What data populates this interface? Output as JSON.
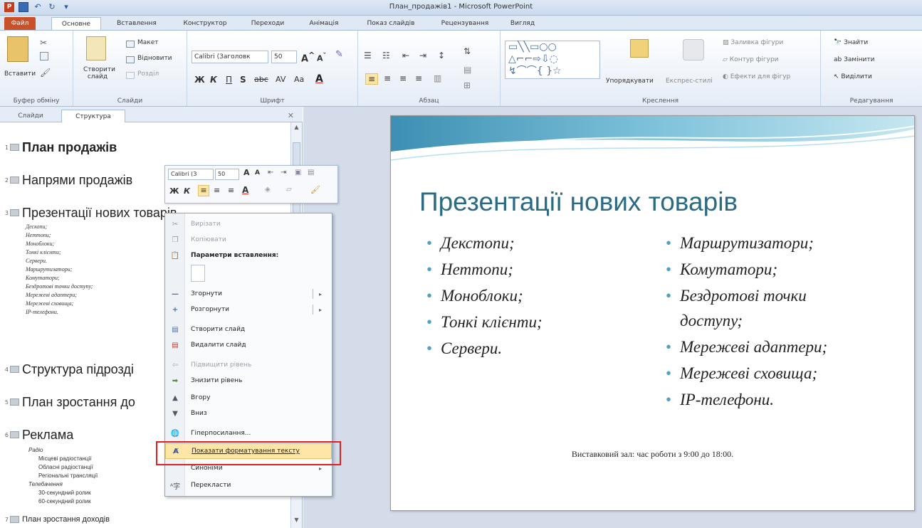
{
  "window": {
    "title": "План_продажів1 - Microsoft PowerPoint",
    "app_logo": "P"
  },
  "ribbon_tabs": [
    "Файл",
    "Основне",
    "Вставлення",
    "Конструктор",
    "Переходи",
    "Анімація",
    "Показ слайдів",
    "Рецензування",
    "Вигляд"
  ],
  "ribbon": {
    "clipboard": {
      "paste": "Вставити",
      "label": "Буфер обміну"
    },
    "slides": {
      "new_slide": "Створити слайд",
      "layout": "Макет",
      "reset": "Відновити",
      "section": "Розділ",
      "label": "Слайди"
    },
    "font": {
      "font_name": "Calibri (Заголовк",
      "font_size": "50",
      "label": "Шрифт",
      "bold": "Ж",
      "italic": "К",
      "underline": "П",
      "strike": "S",
      "case": "Aa"
    },
    "paragraph": {
      "label": "Абзац"
    },
    "drawing": {
      "arrange": "Упорядкувати",
      "quick_styles": "Експрес-стилі",
      "fill": "Заливка фігури",
      "outline": "Контур фігури",
      "effects": "Ефекти для фігур",
      "label": "Креслення"
    },
    "editing": {
      "find": "Знайти",
      "replace": "Замінити",
      "select": "Виділити",
      "label": "Редагування"
    }
  },
  "pane": {
    "tabs": [
      "Слайди",
      "Структура"
    ],
    "slides": [
      {
        "num": "1",
        "title": "План продажів"
      },
      {
        "num": "2",
        "title": "Напрями продажів"
      },
      {
        "num": "3",
        "title": "Презентації нових товарів"
      },
      {
        "num": "4",
        "title": "Структура підрозді"
      },
      {
        "num": "5",
        "title": "План зростання до"
      },
      {
        "num": "6",
        "title": "Реклама"
      },
      {
        "num": "7",
        "title": "План зростання доходів"
      }
    ],
    "slide3_items": [
      "Дескопи;",
      "Неттопи;",
      "Моноблоки;",
      "Тонкі клієнти;",
      "Сервери.",
      "Маршрутизатори;",
      "Комутатори;",
      "Бездротові точки доступу;",
      "Мережеві адаптери;",
      "Мережеві сховища;",
      "IP-телефони."
    ],
    "slide6_items": [
      "Радіо",
      "Місцеві радіостанції",
      "Обласні радіостанції",
      "Регіональні трансляції",
      "Телебачення",
      "30-секундний ролик",
      "60-секундний ролик"
    ]
  },
  "mini_toolbar": {
    "font_name": "Calibri (З",
    "font_size": "50"
  },
  "context_menu": {
    "items": [
      {
        "label": "Вирізати",
        "icon": "scissors-icon",
        "disabled": true
      },
      {
        "label": "Копіювати",
        "icon": "copy-icon",
        "disabled": true
      },
      {
        "label": "Параметри вставлення:",
        "icon": "paste-icon",
        "disabled": false,
        "bold": true
      },
      {
        "label": "Згорнути",
        "icon": "collapse-icon",
        "disabled": false,
        "submenu": true
      },
      {
        "label": "Розгорнути",
        "icon": "expand-icon",
        "disabled": false,
        "submenu": true
      },
      {
        "label": "Створити слайд",
        "icon": "new-slide-icon",
        "disabled": false
      },
      {
        "label": "Видалити слайд",
        "icon": "delete-slide-icon",
        "disabled": false
      },
      {
        "label": "Підвищити рівень",
        "icon": "promote-icon",
        "disabled": true
      },
      {
        "label": "Знизити рівень",
        "icon": "demote-icon",
        "disabled": false
      },
      {
        "label": "Вгору",
        "icon": "move-up-icon",
        "disabled": false
      },
      {
        "label": "Вниз",
        "icon": "move-down-icon",
        "disabled": false
      },
      {
        "label": "Гіперпосилання...",
        "icon": "hyperlink-icon",
        "disabled": false
      },
      {
        "label": "Показати форматування тексту",
        "icon": "show-formatting-icon",
        "disabled": false,
        "highlighted": true
      },
      {
        "label": "Синоніми",
        "icon": "",
        "disabled": false,
        "submenu": true
      },
      {
        "label": "Перекласти",
        "icon": "translate-icon",
        "disabled": false
      }
    ]
  },
  "slide": {
    "title": "Презентації нових товарів",
    "left_bullets": [
      "Декстопи;",
      "Неттопи;",
      "Моноблоки;",
      "Тонкі клієнти;",
      "Сервери."
    ],
    "right_bullets": [
      "Маршрутизатори;",
      "Комутатори;",
      "Бездротові точки",
      "доступу;",
      "Мережеві адаптери;",
      "Мережеві сховища;",
      "IP-телефони."
    ],
    "footer": "Виставковий зал: час роботи з 9:00 до 18:00."
  },
  "colors": {
    "accent": "#2b6a84",
    "file_tab": "#c8512a",
    "highlight": "#fde6a8",
    "callout": "#e02020"
  }
}
